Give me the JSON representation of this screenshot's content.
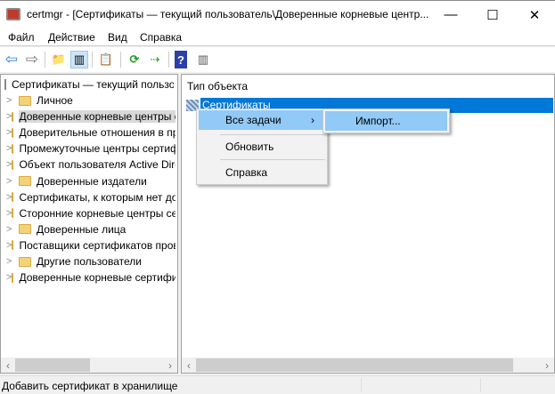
{
  "window": {
    "title": "certmgr - [Сертификаты — текущий пользователь\\Доверенные корневые центр...",
    "minimize": "—",
    "maximize": "☐",
    "close": "✕"
  },
  "menu": [
    "Файл",
    "Действие",
    "Вид",
    "Справка"
  ],
  "toolbar": [
    {
      "icon": "back-arrow-icon",
      "glyph": "⇦"
    },
    {
      "icon": "forward-arrow-icon",
      "glyph": "⇨"
    },
    {
      "icon": "up-folder-icon",
      "glyph": "📁"
    },
    {
      "icon": "show-hide-tree-icon",
      "glyph": "▥"
    },
    {
      "icon": "clipboard-icon",
      "glyph": "📋"
    },
    {
      "icon": "refresh-icon",
      "glyph": "⟳"
    },
    {
      "icon": "export-list-icon",
      "glyph": "⇢"
    },
    {
      "icon": "help-icon",
      "glyph": "?"
    },
    {
      "icon": "action-pane-icon",
      "glyph": "▥"
    }
  ],
  "tree": {
    "root": "Сертификаты — текущий пользователь",
    "items": [
      "Личное",
      "Доверенные корневые центры сертификации",
      "Доверительные отношения в предприятии",
      "Промежуточные центры сертификации",
      "Объект пользователя Active Directory",
      "Доверенные издатели",
      "Сертификаты, к которым нет доверия",
      "Сторонние корневые центры сертификации",
      "Доверенные лица",
      "Поставщики сертификатов проверки подлинности",
      "Другие пользователи",
      "Доверенные корневые сертификаты смарт-карт"
    ]
  },
  "list": {
    "header": "Тип объекта",
    "rows": [
      "Сертификаты"
    ]
  },
  "context_menu": {
    "items": [
      "Все задачи",
      "Обновить",
      "Справка"
    ],
    "submenu": [
      "Импорт..."
    ]
  },
  "status": "Добавить сертификат в хранилище"
}
